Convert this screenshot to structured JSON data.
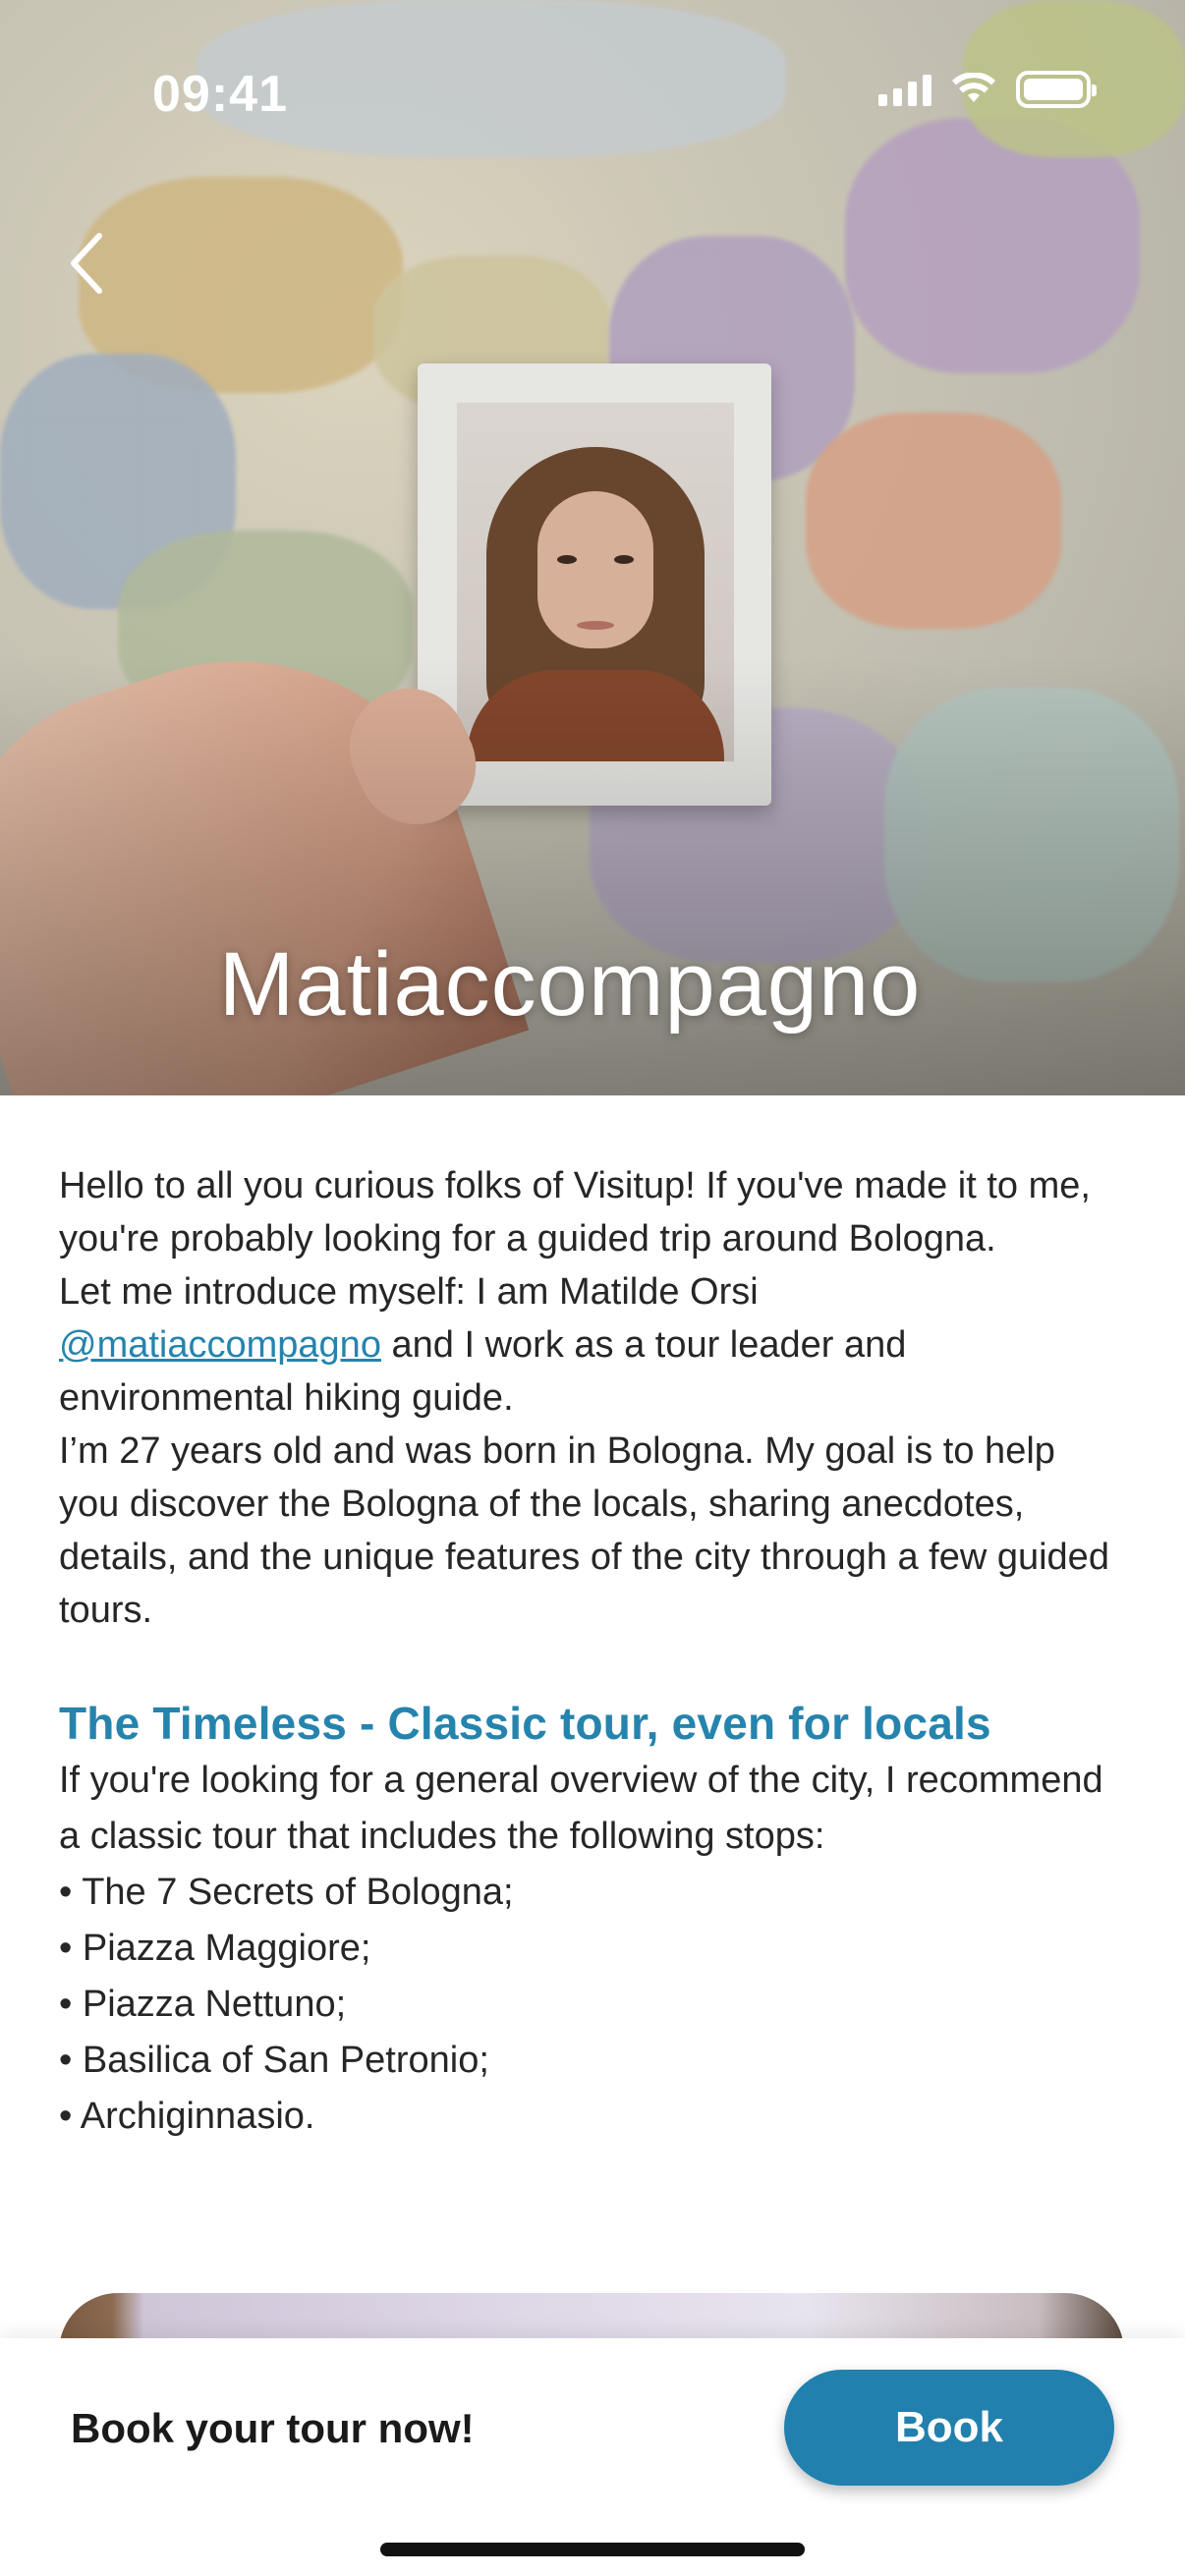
{
  "status_bar": {
    "time": "09:41"
  },
  "hero": {
    "title": "Matiaccompagno",
    "back_icon": "chevron-left-icon"
  },
  "intro": {
    "p1": "Hello to all you curious folks of Visitup! If you've made it to me, you're probably looking for a guided trip around Bologna.",
    "p2_before": "Let me introduce myself: I am Matilde Orsi",
    "mention": "@matiaccompagno",
    "p2_after": " and I work as a tour leader and environmental hiking guide.",
    "p3": "I’m 27 years old and was born in Bologna. My goal is to help you discover the Bologna of the locals, sharing anecdotes, details, and the unique features of the city through a few guided tours."
  },
  "section": {
    "title": "The Timeless - Classic tour, even for locals",
    "text": "If you're looking for a general overview of the city, I recommend a classic tour that includes the following stops:",
    "stops": [
      "The 7 Secrets of Bologna;",
      "Piazza Maggiore;",
      "Piazza Nettuno;",
      "Basilica of San Petronio;",
      "Archiginnasio."
    ]
  },
  "booking": {
    "cta": "Book your tour now!",
    "button_label": "Book"
  },
  "colors": {
    "accent": "#2584ad",
    "button": "#2180ad"
  }
}
